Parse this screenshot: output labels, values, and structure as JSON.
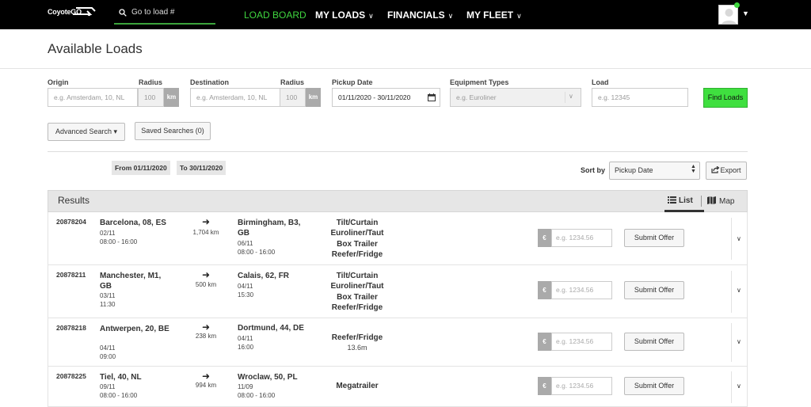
{
  "nav": {
    "logo": "CoyoteGO",
    "search_placeholder": "Go to load #",
    "items": [
      {
        "label": "LOAD BOARD"
      },
      {
        "label": "MY LOADS"
      },
      {
        "label": "FINANCIALS"
      },
      {
        "label": "MY FLEET"
      }
    ],
    "accent_color": "#3fd63f"
  },
  "page": {
    "title": "Available Loads"
  },
  "filters": {
    "origin_label": "Origin",
    "origin_placeholder": "e.g. Amsterdam, 10, NL",
    "radius_label": "Radius",
    "radius_value": "100",
    "radius_unit": "km",
    "destination_label": "Destination",
    "destination_placeholder": "e.g. Amsterdam, 10, NL",
    "dest_radius_label": "Radius",
    "dest_radius_value": "100",
    "dest_radius_unit": "km",
    "pickup_label": "Pickup Date",
    "pickup_value": "01/11/2020 - 30/11/2020",
    "equipment_label": "Equipment Types",
    "equipment_placeholder": "e.g. Euroliner",
    "load_label": "Load",
    "load_placeholder": "e.g. 12345",
    "find_label": "Find Loads",
    "advanced_label": "Advanced Search ▾",
    "saved_label": "Saved Searches (0)"
  },
  "active_filters": {
    "from": "From 01/11/2020",
    "to": "To 30/11/2020"
  },
  "sort": {
    "label": "Sort by",
    "value": "Pickup Date",
    "export_label": "Export"
  },
  "results": {
    "title": "Results",
    "list_label": "List",
    "map_label": "Map",
    "offer_currency": "€",
    "offer_placeholder": "e.g. 1234.56",
    "submit_label": "Submit Offer",
    "loads": [
      {
        "id": "20878204",
        "origin": "Barcelona, 08, ES",
        "origin_date": "02/11",
        "origin_time": "08:00 - 16:00",
        "distance": "1,704 km",
        "destination": "Birmingham, B3, GB",
        "dest_date": "06/11",
        "dest_time": "08:00 - 16:00",
        "equipment": [
          "Tilt/Curtain",
          "Euroliner/Taut",
          "Box Trailer",
          "Reefer/Fridge"
        ],
        "equipment_sub": ""
      },
      {
        "id": "20878211",
        "origin": "Manchester, M1, GB",
        "origin_date": "03/11",
        "origin_time": "11:30",
        "distance": "500 km",
        "destination": "Calais, 62, FR",
        "dest_date": "04/11",
        "dest_time": "15:30",
        "equipment": [
          "Tilt/Curtain",
          "Euroliner/Taut",
          "Box Trailer",
          "Reefer/Fridge"
        ],
        "equipment_sub": ""
      },
      {
        "id": "20878218",
        "origin": "Antwerpen, 20, BE",
        "origin_date": "04/11",
        "origin_time": "09:00",
        "distance": "238 km",
        "destination": "Dortmund, 44, DE",
        "dest_date": "04/11",
        "dest_time": "16:00",
        "equipment": [
          "Reefer/Fridge"
        ],
        "equipment_sub": "13.6m"
      },
      {
        "id": "20878225",
        "origin": "Tiel, 40, NL",
        "origin_date": "09/11",
        "origin_time": "08:00 - 16:00",
        "distance": "994 km",
        "destination": "Wroclaw, 50, PL",
        "dest_date": "11/09",
        "dest_time": "08:00 - 16:00",
        "equipment": [
          "Megatrailer"
        ],
        "equipment_sub": ""
      }
    ]
  }
}
